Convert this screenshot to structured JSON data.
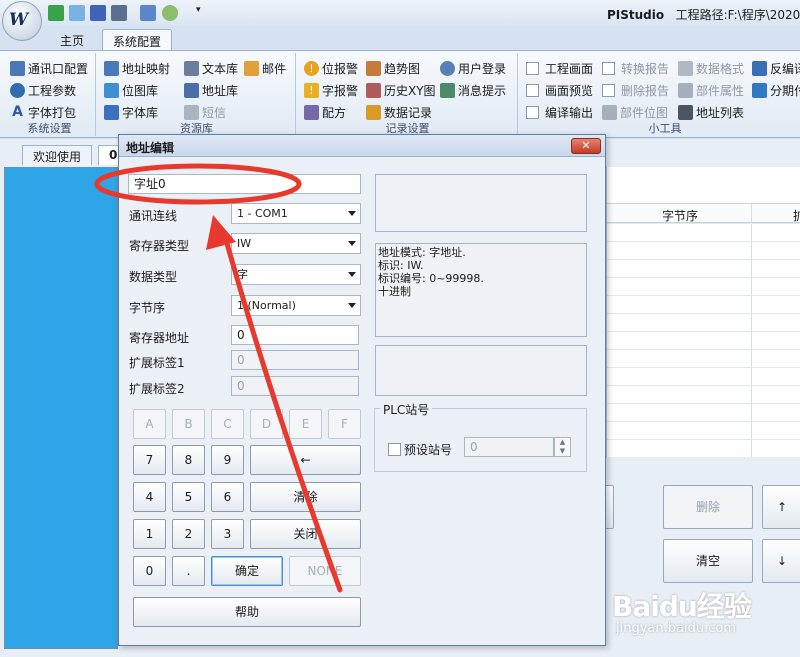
{
  "app": {
    "title_name": "PIStudio",
    "title_path": "工程路径:F:\\程序\\2020\\"
  },
  "ribbon_tabs": [
    "主页",
    "系统配置"
  ],
  "ribbon": {
    "group1": {
      "label": "系统设置",
      "items": [
        "通讯口配置",
        "工程参数",
        "字体打包"
      ]
    },
    "group2": {
      "label": "资源库",
      "items": [
        "地址映射",
        "文本库",
        "邮件",
        "位图库",
        "地址库",
        "字体库",
        "短信"
      ]
    },
    "group3": {
      "label": "记录设置",
      "items": [
        "位报警",
        "趋势图",
        "用户登录",
        "字报警",
        "历史XY图",
        "消息提示",
        "配方",
        "数据记录"
      ]
    },
    "group4": {
      "label": "小工具",
      "items": [
        "工程画面",
        "转换报告",
        "数据格式",
        "反编译",
        "画面预览",
        "删除报告",
        "部件属性",
        "分期付",
        "编译输出",
        "部件位图",
        "地址列表"
      ]
    }
  },
  "doc_tabs": [
    "欢迎使用",
    "0:"
  ],
  "grid": {
    "headers": [
      "字节序",
      "扩"
    ]
  },
  "right_buttons": {
    "delete": "删除",
    "clear": "清空",
    "up": "↑",
    "down": "↓"
  },
  "dialog": {
    "title": "地址编辑",
    "close": "✕",
    "address_value": "字址0",
    "labels": {
      "comm": "通讯连线",
      "reg_type": "寄存器类型",
      "data_type": "数据类型",
      "byte_order": "字节序",
      "reg_addr": "寄存器地址",
      "ext1": "扩展标签1",
      "ext2": "扩展标签2"
    },
    "values": {
      "comm": "1 - COM1",
      "reg_type": "IW",
      "data_type": "字",
      "byte_order": "1 (Normal)",
      "reg_addr": "0",
      "ext1": "0",
      "ext2": "0"
    },
    "info_lines": [
      "地址模式: 字地址.",
      "标识: IW.",
      "标识编号: 0~99998.",
      "十进制"
    ],
    "keypad": {
      "hex": [
        "A",
        "B",
        "C",
        "D",
        "E",
        "F"
      ],
      "row1": [
        "7",
        "8",
        "9"
      ],
      "row2": [
        "4",
        "5",
        "6"
      ],
      "row3": [
        "1",
        "2",
        "3"
      ],
      "zero": "0",
      "dot": ".",
      "backspace": "←",
      "clear": "清除",
      "close": "关闭",
      "ok": "确定",
      "none": "NONE",
      "help": "帮助"
    },
    "plc": {
      "legend": "PLC站号",
      "preset_label": "预设站号",
      "preset_value": "0"
    }
  },
  "watermark": {
    "brand": "Baidu经验",
    "url": "jingyan.baidu.com"
  },
  "colors": {
    "accent_blue": "#2ea5e6",
    "annotation_red": "#e8392d",
    "ribbon_bg": "#e1eaf5"
  }
}
